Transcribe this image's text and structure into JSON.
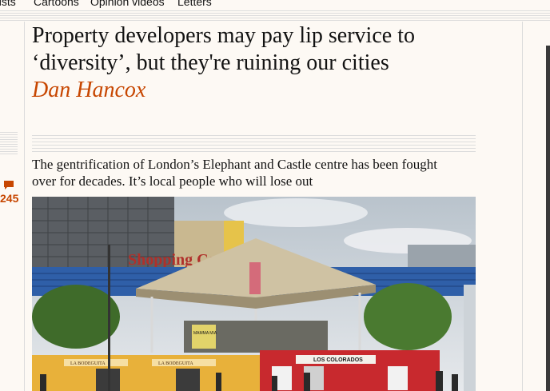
{
  "nav": {
    "items": [
      "nists",
      "Cartoons",
      "Opinion videos",
      "Letters"
    ]
  },
  "article": {
    "headline": "Property developers may pay lip service to ‘diversity’, but they're ruining our cities",
    "byline": "Dan Hancox",
    "standfirst": "The gentrification of London’s Elephant and Castle centre has been fought over for decades. It’s local people who will lose out",
    "comment_count": "245"
  },
  "photo": {
    "sign_text": "Shopping Centre",
    "shop_labels": [
      "LA BODEGUITA",
      "LA BODEGUITA",
      "LOS COLORADOS"
    ],
    "upper_sign": "MAMMA MIA"
  },
  "colors": {
    "accent": "#c74600",
    "background": "#fdf9f4",
    "text": "#121212",
    "rule": "#dcdcdc"
  }
}
